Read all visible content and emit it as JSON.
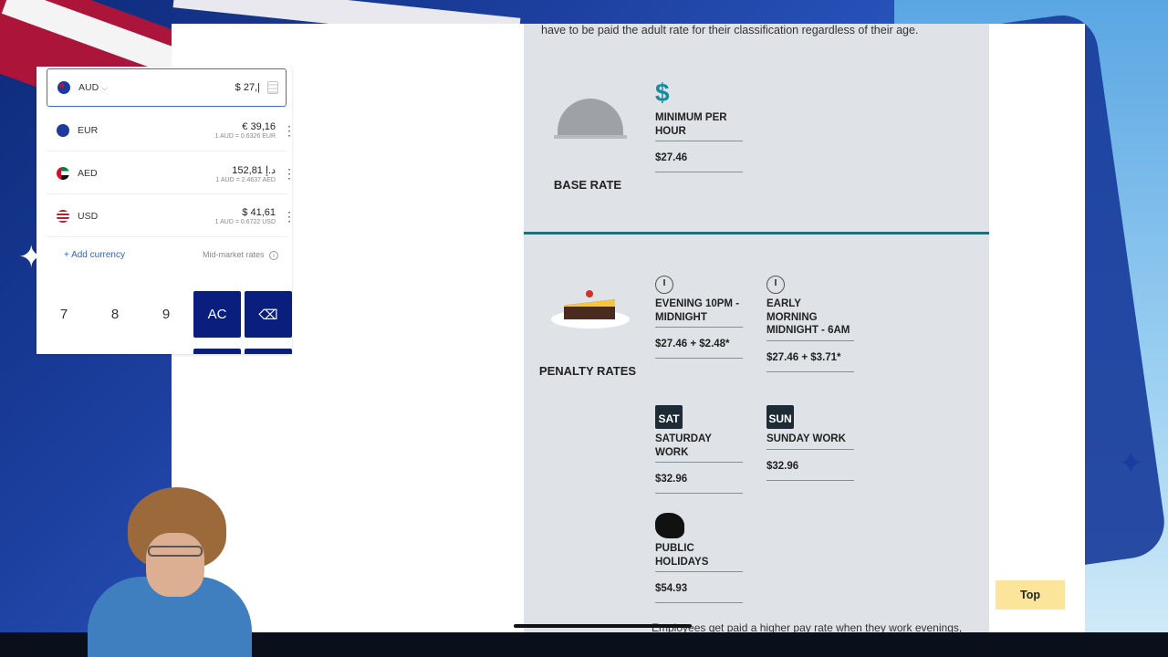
{
  "webpage": {
    "intro_text": "have to be paid the adult rate for their classification regardless of their age.",
    "base_rate": {
      "label": "BASE RATE",
      "items": [
        {
          "title": "MINIMUM PER HOUR",
          "value": "$27.46",
          "icon": "dollar-icon"
        }
      ]
    },
    "penalty_rates": {
      "label": "PENALTY RATES",
      "items": [
        {
          "title": "EVENING 10PM - MIDNIGHT",
          "value": "$27.46 + $2.48*",
          "icon": "stopwatch-icon"
        },
        {
          "title": "EARLY MORNING MIDNIGHT - 6AM",
          "value": "$27.46 + $3.71*",
          "icon": "stopwatch-icon"
        },
        {
          "title": "SATURDAY WORK",
          "value": "$32.96",
          "icon_text": "SAT"
        },
        {
          "title": "SUNDAY WORK",
          "value": "$32.96",
          "icon_text": "SUN"
        },
        {
          "title": "PUBLIC HOLIDAYS",
          "value": "$54.93",
          "icon": "australia-map-icon"
        }
      ]
    },
    "bottom_text": "Employees get paid a higher pay rate when they work evenings,",
    "top_button_label": "Top",
    "accent_color": "#1f6f7a"
  },
  "currency_widget": {
    "rows": [
      {
        "code": "AUD",
        "amount": "$ 27,|",
        "rate": ""
      },
      {
        "code": "EUR",
        "amount": "€ 39,16",
        "rate": "1 AUD = 0.6326 EUR"
      },
      {
        "code": "AED",
        "amount": "152,81 د.إ",
        "rate": "1 AUD = 2.4637 AED"
      },
      {
        "code": "USD",
        "amount": "$ 41,61",
        "rate": "1 AUD = 0.6722 USD"
      }
    ],
    "add_currency_label": "Add currency",
    "add_icon": "+",
    "mid_market_label": "Mid-market rates",
    "info_icon": "i",
    "keys": [
      "7",
      "8",
      "9",
      "AC",
      "⌫"
    ],
    "dropdown_icon": "⌵",
    "more_icon": "⋮",
    "accent_color": "#0a1f7d"
  },
  "background": {
    "star_glyph": "✦"
  }
}
